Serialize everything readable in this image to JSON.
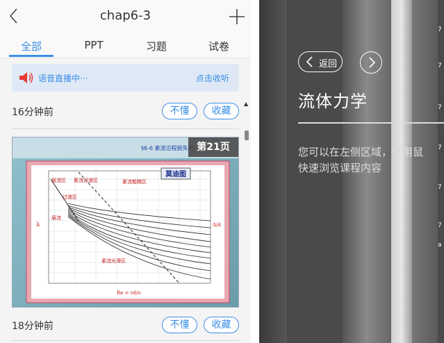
{
  "header": {
    "title": "chap6-3"
  },
  "tabs": [
    {
      "label": "全部",
      "active": true
    },
    {
      "label": "PPT",
      "active": false
    },
    {
      "label": "习题",
      "active": false
    },
    {
      "label": "试卷",
      "active": false
    }
  ],
  "live": {
    "status": "语音直播中···",
    "action": "点击收听"
  },
  "posts": [
    {
      "time": "16分钟前",
      "dont_understand": "不懂",
      "favorite": "收藏"
    },
    {
      "time": "18分钟前",
      "dont_understand": "不懂",
      "favorite": "收藏"
    }
  ],
  "slide": {
    "page_badge": "第21页",
    "heading": "§6-6 紊流沿程损失的",
    "chart_title": "莫迪图",
    "labels": {
      "laminar_zone": "层流区",
      "laminar_transition": "紊流过渡区",
      "rough_zone": "紊流粗糙区",
      "transition_zone": "过渡区",
      "laminar": "层流",
      "smooth_zone": "紊流光滑区",
      "lambda": "λ",
      "ratio": "Δ/d",
      "re": "Re = vd/ν"
    }
  },
  "right_panel": {
    "back_label": "返回",
    "course_title": "流体力学",
    "hint_lines": [
      "您可以在左侧区域，使用鼠",
      "快速浏览课程内容"
    ],
    "edge_marks": [
      "7",
      "7",
      "7",
      "7",
      "7",
      "7",
      "a"
    ]
  },
  "colors": {
    "accent": "#3a8ee6",
    "live_bg": "#dfe9f6",
    "right_bg": "#4a4a4a"
  }
}
